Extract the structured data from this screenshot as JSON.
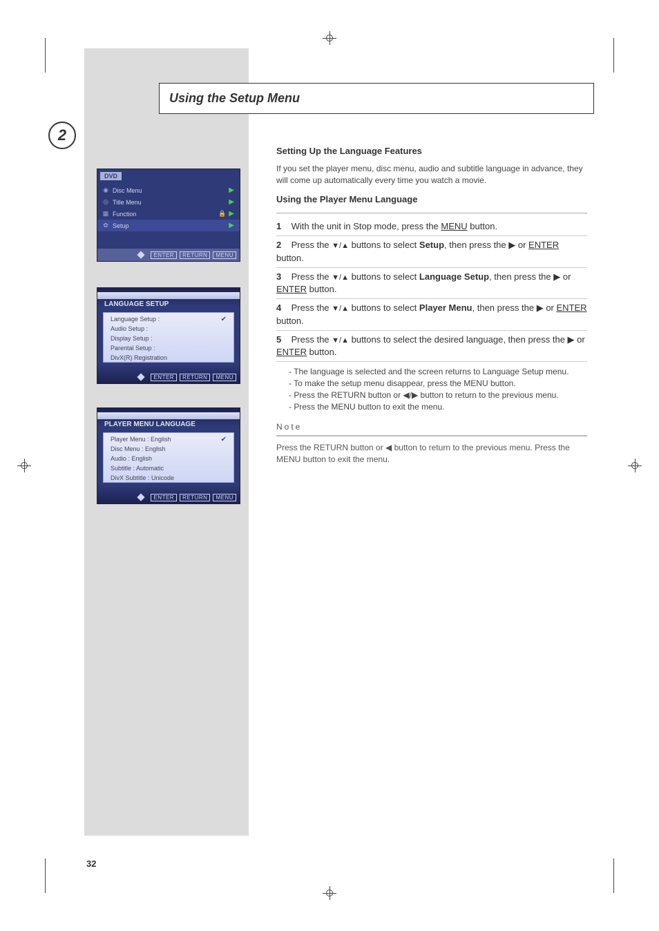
{
  "domain": "Document",
  "page_number": "32",
  "section_title": "Using the Setup Menu",
  "step_badge": "2",
  "instructions": {
    "heading": "Setting Up the Language Features",
    "intro": "If you set the player menu, disc menu, audio and subtitle language in advance, they will come up automatically every time you watch a movie.",
    "subhead": "Using the Player Menu Language",
    "steps": [
      {
        "num": "1",
        "text_a": "With the unit in Stop mode, press the ",
        "act": "MENU",
        "text_b": " button."
      },
      {
        "num": "2",
        "text_a": "Press the ",
        "tri": "▼/▲",
        "text_b": " buttons to select ",
        "bold": "Setup",
        "text_c": ", then press the ▶ or ",
        "act": "ENTER",
        "text_d": " button."
      },
      {
        "num": "3",
        "text_a": "Press the ",
        "tri": "▼/▲",
        "text_b": " buttons to select ",
        "bold": "Language Setup",
        "text_c": ", then press the ▶ or ",
        "act": "ENTER",
        "text_d": " button."
      },
      {
        "num": "4",
        "text_a": "Press the ",
        "tri": "▼/▲",
        "text_b": " buttons to select ",
        "bold": "Player Menu",
        "text_c": ", then press the ▶ or ",
        "act": "ENTER",
        "text_d": " button."
      },
      {
        "num": "5",
        "text_a": "Press the ",
        "tri": "▼/▲",
        "text_b": " buttons to select the desired language, then press the ▶ or ",
        "act": "ENTER",
        "text_c": " button."
      }
    ],
    "bullets": [
      "The language is selected and the screen returns to Language Setup menu.",
      "To make the setup menu disappear, press the MENU button.",
      "Press the RETURN button or ◀/▶ button to return to the previous menu.",
      "Press the MENU button to exit the menu."
    ],
    "note_label": "Note",
    "note_text": "Press the RETURN button or ◀ button to return to the previous menu. Press the MENU button to exit the menu."
  },
  "osd1": {
    "tab": "DVD",
    "rows": [
      {
        "icon": "disc",
        "label": "Disc Menu",
        "rhs": "play"
      },
      {
        "icon": "title",
        "label": "Title Menu",
        "rhs": "play"
      },
      {
        "icon": "grid",
        "label": "Function",
        "rhs": "lockplay",
        "highlight": false
      },
      {
        "icon": "gear",
        "label": "Setup",
        "rhs": "play",
        "highlight": true
      }
    ],
    "footer": [
      "ENTER",
      "RETURN",
      "MENU"
    ]
  },
  "osd2": {
    "title": "LANGUAGE SETUP",
    "items": [
      {
        "label": "Language Setup    :",
        "checked": true
      },
      {
        "label": "Audio Setup        :"
      },
      {
        "label": "Display Setup      :"
      },
      {
        "label": "Parental Setup    :"
      },
      {
        "label": "DivX(R) Registration"
      }
    ],
    "footer": [
      "ENTER",
      "RETURN",
      "MENU"
    ]
  },
  "osd3": {
    "title": "PLAYER MENU LANGUAGE",
    "items": [
      {
        "label": "Player Menu         : English",
        "checked": true
      },
      {
        "label": "Disc Menu           : English"
      },
      {
        "label": "Audio               : English"
      },
      {
        "label": "Subtitle            : Automatic"
      },
      {
        "label": "DivX Subtitle       : Unicode"
      }
    ],
    "footer": [
      "ENTER",
      "RETURN",
      "MENU"
    ]
  }
}
